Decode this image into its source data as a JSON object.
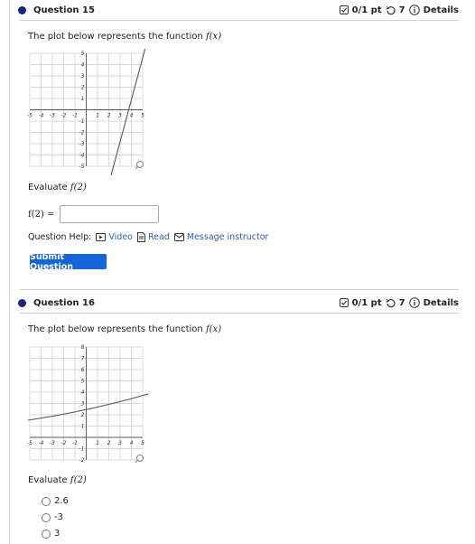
{
  "q15": {
    "title": "Question 15",
    "score": "0/1 pt",
    "attempts": "7",
    "details": "Details",
    "prompt": "The plot below represents the function",
    "fx": "f(x)",
    "evaluate_label": "Evaluate",
    "evaluate_expr": "f(2)",
    "answer_label": "f(2) =",
    "answer_value": "",
    "help_label": "Question Help:",
    "help_video": "Video",
    "help_read": "Read",
    "help_message": "Message instructor",
    "submit_label": "Submit Question",
    "graph": {
      "xticks": [
        "-5",
        "-4",
        "-3",
        "-2",
        "-1",
        "1",
        "2",
        "3",
        "4",
        "5"
      ],
      "yticks": [
        "5",
        "4",
        "3",
        "2",
        "1",
        "-1",
        "-2",
        "-3",
        "-4",
        "-5"
      ]
    }
  },
  "q16": {
    "title": "Question 16",
    "score": "0/1 pt",
    "attempts": "7",
    "details": "Details",
    "prompt": "The plot below represents the function",
    "fx": "f(x)",
    "evaluate_label": "Evaluate",
    "evaluate_expr": "f(2)",
    "choices": [
      "2.6",
      "-3",
      "3"
    ],
    "graph": {
      "xticks": [
        "-5",
        "-4",
        "-3",
        "-2",
        "-1",
        "1",
        "2",
        "3",
        "4",
        "5"
      ],
      "yticks": [
        "8",
        "7",
        "6",
        "5",
        "4",
        "3",
        "2",
        "1",
        "-1",
        "-2"
      ]
    }
  },
  "colors": {
    "bullet": "#1a237e",
    "button": "#1565d8",
    "link": "#2b5fb8"
  },
  "icons": [
    "checkbox-icon",
    "retry-icon",
    "info-icon",
    "video-icon",
    "read-icon",
    "mail-icon",
    "zoom-icon"
  ]
}
